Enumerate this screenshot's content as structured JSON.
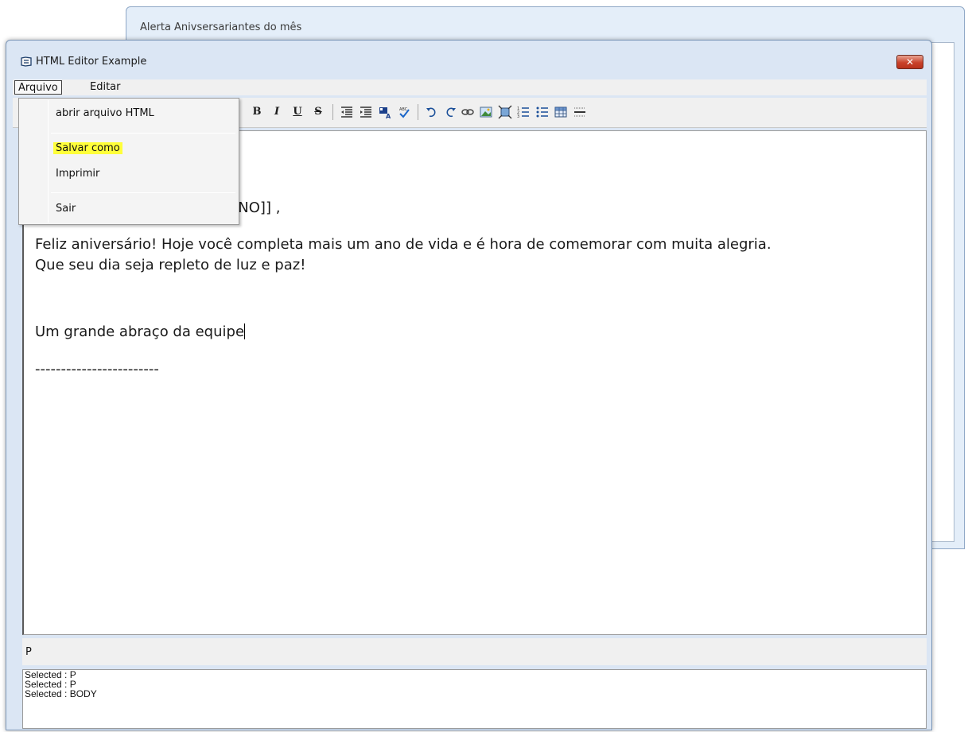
{
  "background_window": {
    "title": "Alerta Anivsersariantes do mês"
  },
  "window": {
    "title": "HTML Editor Example",
    "close_label": "✕"
  },
  "menubar": {
    "items": [
      {
        "label": "Arquivo"
      },
      {
        "label": "Editar"
      }
    ]
  },
  "dropdown": {
    "items": [
      {
        "label": "abrir arquivo HTML"
      },
      {
        "label": "Salvar como",
        "highlighted": true
      },
      {
        "label": "Imprimir"
      },
      {
        "label": "Sair"
      }
    ]
  },
  "toolbar": {
    "bold": "B",
    "italic": "I",
    "underline": "U",
    "strike": "S"
  },
  "editor": {
    "partial_line": "TINO]] ,",
    "para1_line1": "Feliz aniversário! Hoje você completa mais um ano de vida e é hora de comemorar com muita alegria.",
    "para1_line2": "Que seu dia seja repleto de luz e paz!",
    "closing": "Um grande abraço da equipe",
    "divider": "------------------------"
  },
  "tagbar": {
    "current_tag": "P"
  },
  "log": {
    "lines": [
      "Selected : P",
      "Selected : P",
      "Selected : BODY"
    ]
  },
  "colors": {
    "highlight": "#ffff3a",
    "close_button": "#c9422a"
  }
}
